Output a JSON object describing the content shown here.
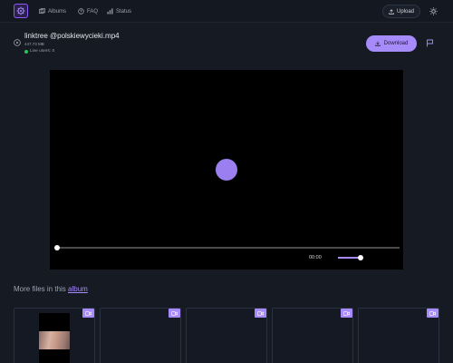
{
  "nav": {
    "links": [
      {
        "label": "Albums",
        "icon": "albums-icon"
      },
      {
        "label": "FAQ",
        "icon": "help-circle-icon"
      },
      {
        "label": "Status",
        "icon": "status-bars-icon"
      }
    ],
    "upload_label": "Upload"
  },
  "file": {
    "name": "linktree @polskiewycieki.mp4",
    "size": "447.73 MB",
    "live_users": "Live users: 0",
    "download_label": "Download"
  },
  "player": {
    "time": "00:00",
    "progress": 0,
    "volume": 1.0
  },
  "more": {
    "text": "More files in this ",
    "album_link": "album"
  },
  "thumbnails": [
    {
      "type": "video",
      "has_preview": true
    },
    {
      "type": "video",
      "has_preview": false
    },
    {
      "type": "video",
      "has_preview": false
    },
    {
      "type": "video",
      "has_preview": false
    },
    {
      "type": "video",
      "has_preview": false
    }
  ],
  "colors": {
    "accent": "#a78bfa",
    "background": "#151a23",
    "live": "#22c55e"
  }
}
